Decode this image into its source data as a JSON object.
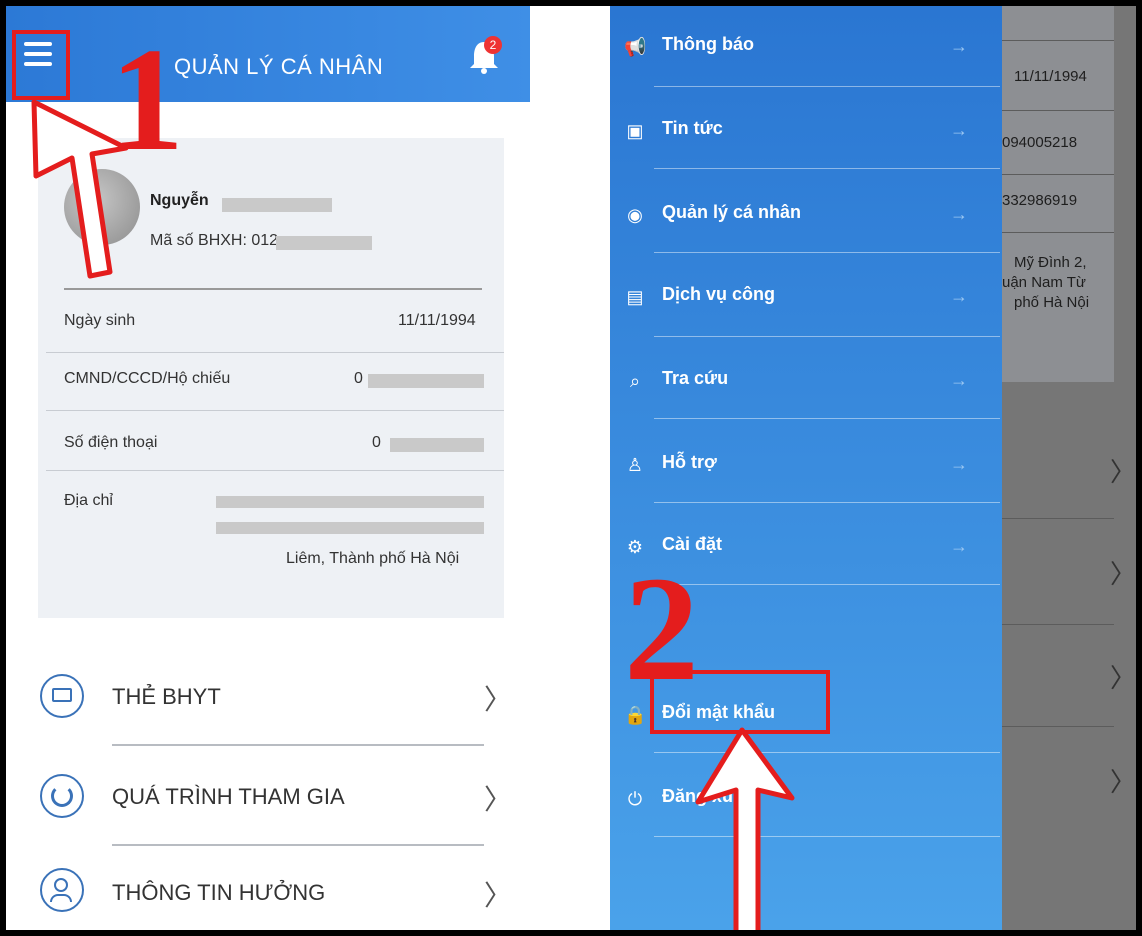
{
  "left": {
    "title": "QUẢN LÝ CÁ NHÂN",
    "notification_count": "2",
    "profile": {
      "name": "Nguyễn",
      "social_insurance_label": "Mã số BHXH: 012"
    },
    "info_rows": [
      {
        "label": "Ngày sinh",
        "value": "11/11/1994"
      },
      {
        "label": "CMND/CCCD/Hộ chiếu",
        "value": "0"
      },
      {
        "label": "Số điện thoại",
        "value": "0"
      },
      {
        "label": "Địa chỉ",
        "value": "Liêm, Thành phố Hà Nội"
      }
    ],
    "features": [
      {
        "label": "THẺ BHYT"
      },
      {
        "label": "QUÁ TRÌNH THAM GIA"
      },
      {
        "label": "THÔNG TIN HƯỞNG"
      }
    ],
    "annotation_number": "1"
  },
  "right": {
    "menu": [
      {
        "label": "Thông báo",
        "icon": "megaphone-icon",
        "glyph": "📢"
      },
      {
        "label": "Tin tức",
        "icon": "news-icon",
        "glyph": "▣"
      },
      {
        "label": "Quản lý cá nhân",
        "icon": "personal-manage-icon",
        "glyph": "◉"
      },
      {
        "label": "Dịch vụ công",
        "icon": "public-service-icon",
        "glyph": "▤"
      },
      {
        "label": "Tra cứu",
        "icon": "lookup-icon",
        "glyph": "⌕"
      },
      {
        "label": "Hỗ trợ",
        "icon": "support-icon",
        "glyph": "♙"
      },
      {
        "label": "Cài đặt",
        "icon": "settings-icon",
        "glyph": "⚙"
      },
      {
        "label": "Đổi mật khẩu",
        "icon": "lock-icon",
        "glyph": "🔒"
      },
      {
        "label": "Đăng xuất",
        "icon": "power-icon",
        "glyph": "⏻"
      }
    ],
    "background_values": [
      "11/11/1994",
      "094005218",
      "332986919",
      "Mỹ Đình 2,",
      "uận Nam Từ",
      "phố Hà Nội"
    ],
    "annotation_number": "2"
  },
  "colors": {
    "accent": "#2c79d6",
    "annotation_red": "#e41d1d"
  }
}
